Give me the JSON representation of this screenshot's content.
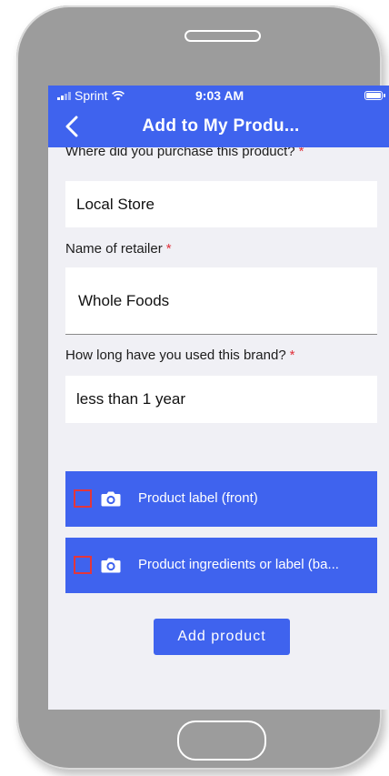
{
  "status_bar": {
    "carrier": "Sprint",
    "time": "9:03 AM"
  },
  "nav": {
    "title": "Add to My Produ..."
  },
  "form": {
    "purchase_question": "Where did you purchase this product?",
    "purchase_value": "Local Store",
    "retailer_label": "Name of retailer",
    "retailer_value": "Whole Foods",
    "brand_duration_label": "How long have you used this brand?",
    "brand_duration_value": "less than 1 year",
    "required_marker": "*"
  },
  "photos": [
    {
      "label": "Product label (front)",
      "checked": false
    },
    {
      "label": "Product ingredients or label (ba...",
      "checked": false
    }
  ],
  "add_button_label": "Add product",
  "colors": {
    "accent": "#3f63ee",
    "background": "#f0f0f5",
    "required": "#e0303a",
    "checkbox_border": "#e3363b",
    "phone_shell": "#9c9c9c"
  },
  "icons": {
    "back": "chevron-left-icon",
    "camera": "camera-icon",
    "wifi": "wifi-icon",
    "battery": "battery-icon",
    "signal": "signal-icon"
  }
}
